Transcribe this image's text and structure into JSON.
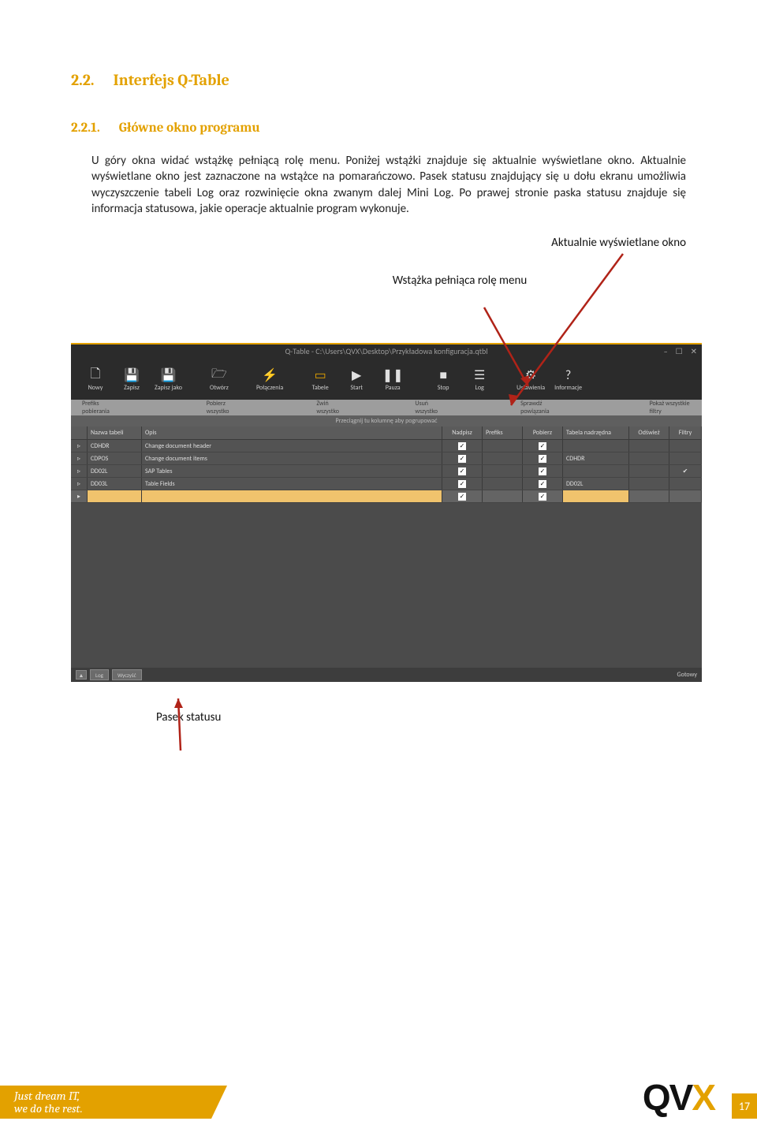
{
  "heading1": {
    "num": "2.2.",
    "title": "Interfejs Q-Table"
  },
  "heading2": {
    "num": "2.2.1.",
    "title": "Główne okno programu"
  },
  "para": "U góry okna widać wstążkę pełniącą rolę menu. Poniżej wstążki znajduje się aktualnie wyświetlane okno. Aktualnie wyświetlane okno jest zaznaczone na wstążce na pomarańczowo. Pasek statusu znajdujący się u dołu ekranu umożliwia wyczyszczenie tabeli Log oraz rozwinięcie okna zwanym dalej Mini Log. Po prawej stronie paska statusu znajduje się informacja statusowa, jakie operacje aktualnie program wykonuje.",
  "annotations": {
    "a1": "Aktualnie wyświetlane okno",
    "a2": "Wstążka pełniąca rolę menu",
    "a3": "Pasek statusu"
  },
  "window": {
    "title": "Q-Table - C:\\Users\\QVX\\Desktop\\Przykładowa konfiguracja.qtbl",
    "min": "–",
    "max": "☐",
    "close": "✕"
  },
  "ribbon": [
    {
      "icon": "🗋",
      "label": "Nowy"
    },
    {
      "icon": "💾",
      "label": "Zapisz"
    },
    {
      "icon": "💾",
      "label": "Zapisz jako"
    },
    {
      "icon": "🗁",
      "label": "Otwórz"
    },
    {
      "icon": "⚡",
      "label": "Połączenia"
    },
    {
      "icon": "▭",
      "label": "Tabele",
      "active": true
    },
    {
      "icon": "▶",
      "label": "Start"
    },
    {
      "icon": "❚❚",
      "label": "Pauza"
    },
    {
      "icon": "■",
      "label": "Stop"
    },
    {
      "icon": "☰",
      "label": "Log"
    },
    {
      "icon": "⚙",
      "label": "Ustawienia"
    },
    {
      "icon": "?",
      "label": "Informacje"
    }
  ],
  "commands": [
    "Prefiks pobierania",
    "Pobierz wszystko",
    "Zwiń wszystko",
    "Usuń wszystko",
    "Sprawdź powiązania",
    "Pokaż wszystkie filtry"
  ],
  "groupHint": "Przeciągnij tu kolumnę aby pogrupować",
  "columns": [
    "",
    "Nazwa tabeli",
    "Opis",
    "Nadpisz",
    "Prefiks",
    "Pobierz",
    "Tabela nadrzędna",
    "Odśwież",
    "Filtry"
  ],
  "rows": [
    {
      "name": "CDHDR",
      "desc": "Change document header",
      "nad": true,
      "pob": true,
      "tab": "",
      "fil": false
    },
    {
      "name": "CDPOS",
      "desc": "Change document items",
      "nad": true,
      "pob": true,
      "tab": "CDHDR",
      "fil": false
    },
    {
      "name": "DD02L",
      "desc": "SAP Tables",
      "nad": true,
      "pob": true,
      "tab": "",
      "fil": true
    },
    {
      "name": "DD03L",
      "desc": "Table Fields",
      "nad": true,
      "pob": true,
      "tab": "DD02L",
      "fil": false
    }
  ],
  "status": {
    "log": "Log",
    "clear": "Wyczyść",
    "ready": "Gotowy"
  },
  "footer": {
    "line1": "Just dream IT,",
    "line2": "we do the rest.",
    "page": "17",
    "logo1": "QV",
    "logo2": "X"
  }
}
